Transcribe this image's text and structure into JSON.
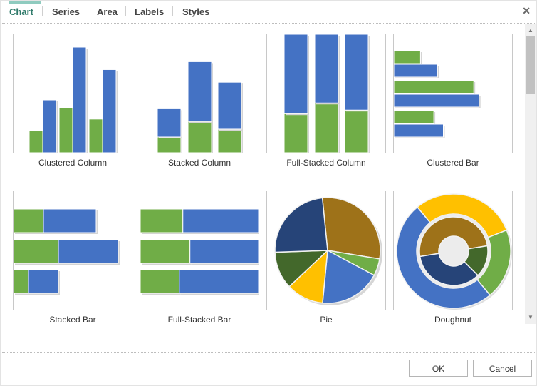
{
  "tabs": [
    {
      "label": "Chart",
      "active": true
    },
    {
      "label": "Series",
      "active": false
    },
    {
      "label": "Area",
      "active": false
    },
    {
      "label": "Labels",
      "active": false
    },
    {
      "label": "Styles",
      "active": false
    }
  ],
  "close_icon": "close-icon",
  "chart_types": [
    {
      "label": "Clustered Column",
      "kind": "clustered-column",
      "selected": false
    },
    {
      "label": "Stacked Column",
      "kind": "stacked-column",
      "selected": false
    },
    {
      "label": "Full-Stacked Column",
      "kind": "full-stacked-column",
      "selected": false
    },
    {
      "label": "Clustered Bar",
      "kind": "clustered-bar",
      "selected": false
    },
    {
      "label": "Stacked Bar",
      "kind": "stacked-bar",
      "selected": false
    },
    {
      "label": "Full-Stacked Bar",
      "kind": "full-stacked-bar",
      "selected": false
    },
    {
      "label": "Pie",
      "kind": "pie",
      "selected": false
    },
    {
      "label": "Doughnut",
      "kind": "doughnut",
      "selected": false
    }
  ],
  "colors": {
    "accent": "#2f7a6a",
    "tab_highlight": "#8fcbbf",
    "green": "#70ad47",
    "blue": "#4472c4",
    "navy": "#264478",
    "dark_green": "#43682b",
    "gold": "#ffc000",
    "brown": "#9e7219"
  },
  "preview_data": {
    "series_a": [
      2,
      4,
      3
    ],
    "series_b": [
      4,
      8,
      6.3
    ],
    "pie": [
      28,
      5,
      18,
      11,
      11,
      23
    ],
    "doughnut_outer": [
      30,
      20,
      50
    ],
    "doughnut_inner": [
      50,
      15,
      35
    ]
  },
  "scrollbar": {
    "up_icon": "▲",
    "down_icon": "▼"
  },
  "footer": {
    "ok_label": "OK",
    "cancel_label": "Cancel"
  }
}
